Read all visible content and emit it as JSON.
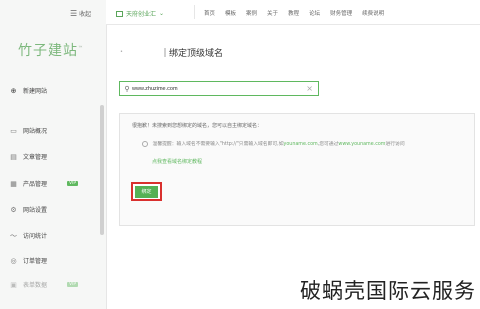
{
  "sidebar": {
    "collapse_label": "收起",
    "logo": "竹子建站",
    "logo_tm": "™",
    "new_site": "新建网站",
    "items": [
      {
        "label": "网站概况",
        "icon": "monitor-icon"
      },
      {
        "label": "文章管理",
        "icon": "document-icon"
      },
      {
        "label": "产品管理",
        "icon": "grid-icon",
        "badge": "VIP"
      },
      {
        "label": "网站设置",
        "icon": "gear-icon"
      },
      {
        "label": "访问统计",
        "icon": "chart-icon"
      },
      {
        "label": "订单管理",
        "icon": "order-icon"
      },
      {
        "label": "表单数据",
        "icon": "form-icon",
        "badge": "VIP"
      }
    ]
  },
  "topbar": {
    "site_name": "天府创业汇",
    "nav": [
      "首页",
      "模板",
      "案例",
      "关于",
      "教程",
      "论坛",
      "财务管理",
      "续费说明"
    ]
  },
  "main": {
    "title": "绑定顶级域名",
    "search_value": "www.zhuzime.com",
    "msg_primary": "很抱歉！未搜索到您想绑定的域名，您可以自主绑定域名：",
    "msg_secondary_a": "温馨提醒：输入域名不需要输入\"http://\"只需输入域名即可,如",
    "msg_secondary_ex1": "youname.com",
    "msg_secondary_b": ",您可通过",
    "msg_secondary_ex2": "www.youname.com",
    "msg_secondary_c": "进行访问",
    "tutorial_link": "点我查看域名绑定教程",
    "bind_button": "绑定"
  },
  "watermark": "破蜗壳国际云服务",
  "colors": {
    "accent": "#5fb85f",
    "highlight": "#d9302e"
  }
}
